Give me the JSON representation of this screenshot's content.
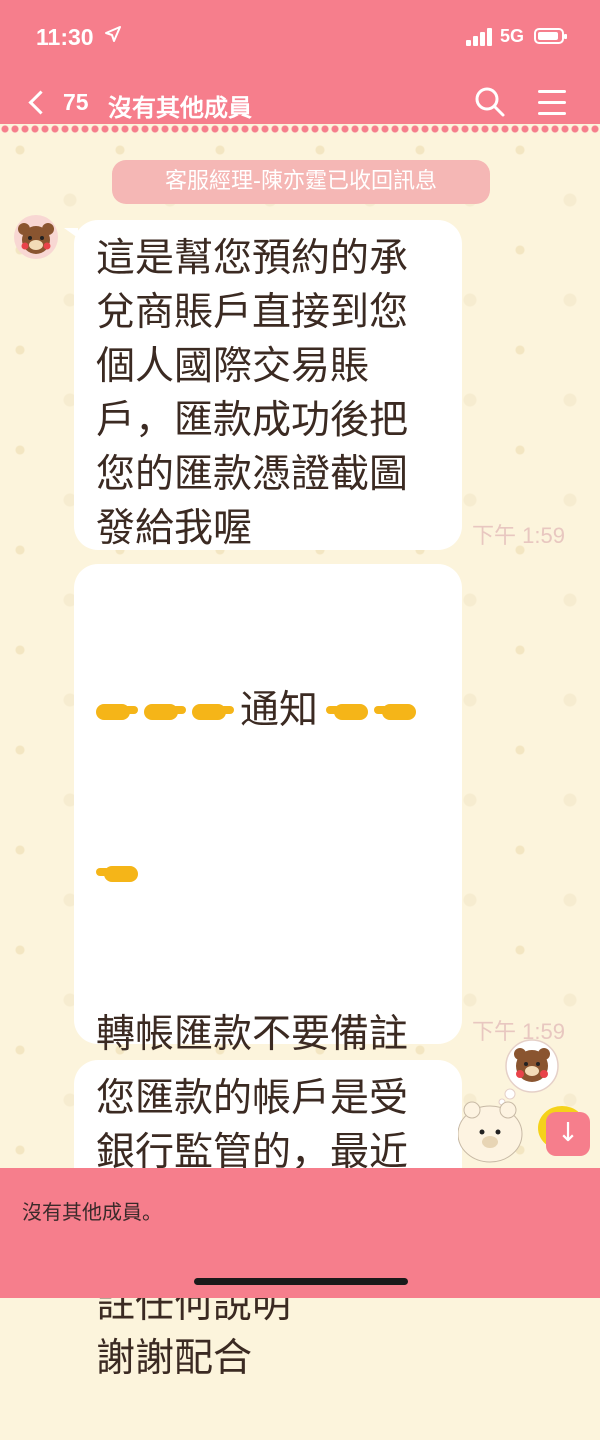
{
  "status_bar": {
    "time": "11:30",
    "location_icon": "location-arrow-icon",
    "network": "5G"
  },
  "header": {
    "back_count": "75",
    "title": "沒有其他成員",
    "search_icon": "search-icon",
    "menu_icon": "menu-icon"
  },
  "system_notice": "客服經理-陳亦霆已收回訊息",
  "messages": [
    {
      "text": "這是幫您預約的承\n兌商賬戶直接到您\n個人國際交易賬\n戶，匯款成功後把\n您的匯款憑證截圖\n發給我喔",
      "time": "下午 1:59"
    },
    {
      "headline": "通知",
      "text": "轉帳匯款不要備註\n任何說明\n如有備註，銀行拒\n絕收款。\n切記轉帳時不要備\n註任何說明\n謝謝配合",
      "time": "下午 1:59"
    },
    {
      "text": "您匯款的帳戶是受\n銀行監管的，最近"
    }
  ],
  "bottom_bar": {
    "text": "沒有其他成員。"
  },
  "colors": {
    "accent": "#f67e8c",
    "background": "#fcf4dc",
    "bubble": "#ffffff",
    "text": "#3b2a22"
  }
}
